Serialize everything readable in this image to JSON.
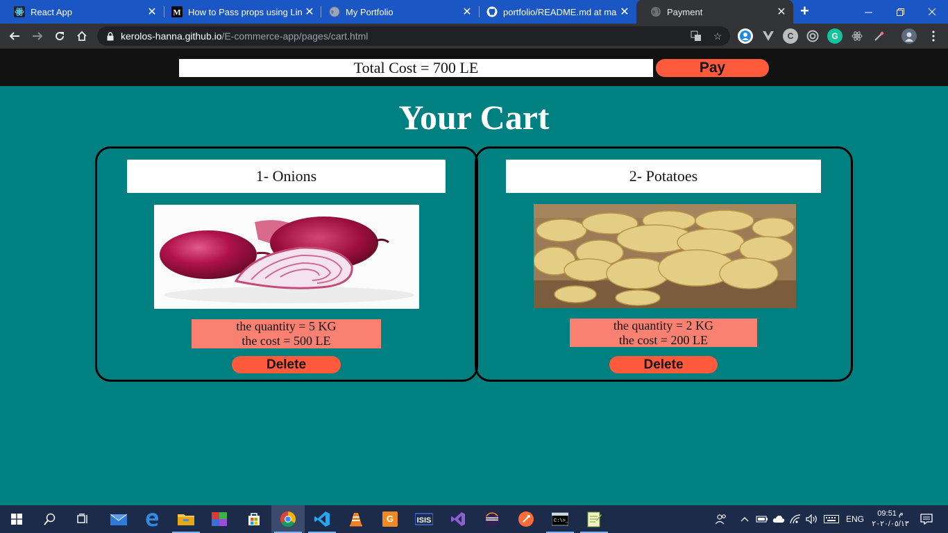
{
  "browser": {
    "tabs": [
      {
        "title": "React App",
        "favicon": "react-icon",
        "active": false
      },
      {
        "title": "How to Pass props using Link a",
        "favicon": "medium-icon",
        "active": false
      },
      {
        "title": "My Portfolio",
        "favicon": "globe-icon",
        "active": false
      },
      {
        "title": "portfolio/README.md at maste",
        "favicon": "github-icon",
        "active": false
      },
      {
        "title": "Payment",
        "favicon": "globe-icon",
        "active": true
      }
    ],
    "url_host": "kerolos-hanna.github.io",
    "url_path": "/E-commerce-app/pages/cart.html"
  },
  "page": {
    "total_cost": "Total Cost = 700 LE",
    "pay_label": "Pay",
    "title": "Your Cart",
    "items": [
      {
        "name": "1- Onions",
        "quantity": "the quantity = 5 KG",
        "cost": "the cost = 500 LE",
        "delete_label": "Delete",
        "image": "onions"
      },
      {
        "name": "2- Potatoes",
        "quantity": "the quantity = 2 KG",
        "cost": "the cost = 200 LE",
        "delete_label": "Delete",
        "image": "potatoes"
      }
    ]
  },
  "taskbar": {
    "language": "ENG",
    "time": "09:51 م",
    "date": "٢٠٢٠/٠٥/١٣"
  },
  "colors": {
    "page_background": "#008080",
    "accent_button": "#ff5a3c",
    "info_box": "#fa8072",
    "header_bar": "#111111"
  }
}
